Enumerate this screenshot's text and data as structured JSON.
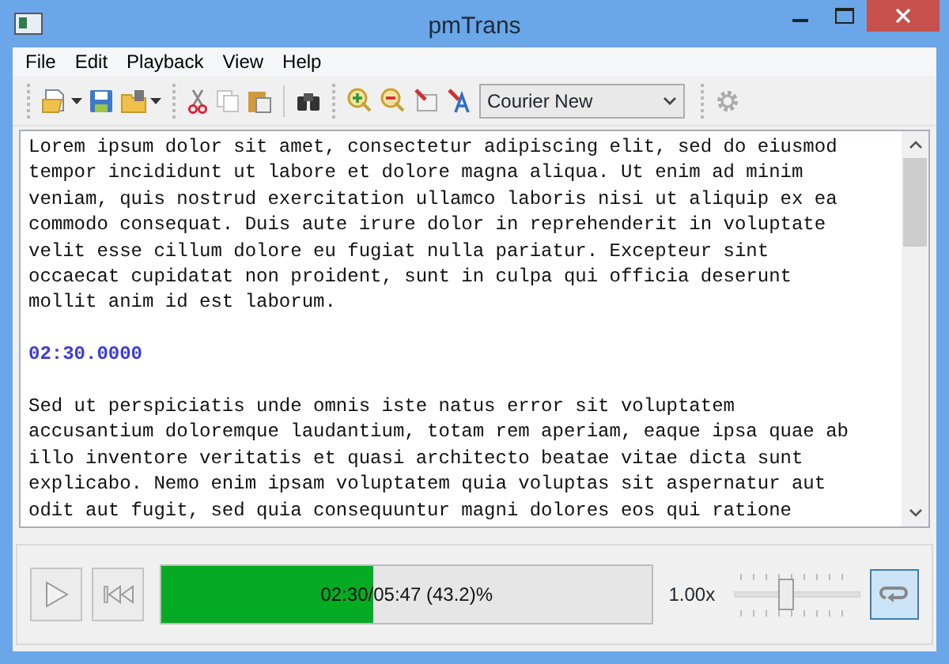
{
  "window": {
    "title": "pmTrans"
  },
  "menu": [
    "File",
    "Edit",
    "Playback",
    "View",
    "Help"
  ],
  "toolbar": {
    "font_select": {
      "value": "Courier New"
    }
  },
  "editor": {
    "blocks": [
      {
        "kind": "text",
        "lines": [
          "Lorem ipsum dolor sit amet, consectetur adipiscing elit, sed do eiusmod",
          "tempor incididunt ut labore et dolore magna aliqua. Ut enim ad minim",
          "veniam, quis nostrud exercitation ullamco laboris nisi ut aliquip ex ea",
          "commodo consequat. Duis aute irure dolor in reprehenderit in voluptate",
          "velit esse cillum dolore eu fugiat nulla pariatur. Excepteur sint",
          "occaecat cupidatat non proident, sunt in culpa qui officia deserunt",
          "mollit anim id est laborum."
        ]
      },
      {
        "kind": "timestamp",
        "text": "02:30.0000"
      },
      {
        "kind": "text",
        "lines": [
          "Sed ut perspiciatis unde omnis iste natus error sit voluptatem",
          "accusantium doloremque laudantium, totam rem aperiam, eaque ipsa quae ab",
          "illo inventore veritatis et quasi architecto beatae vitae dicta sunt",
          "explicabo. Nemo enim ipsam voluptatem quia voluptas sit aspernatur aut",
          "odit aut fugit, sed quia consequuntur magni dolores eos qui ratione"
        ]
      }
    ]
  },
  "player": {
    "progress": {
      "level": 0.432,
      "label": "02:30/05:47 (43.2)%"
    },
    "speed": "1.00x",
    "speed_slider": {
      "level": 0.42
    },
    "loop": {
      "checked": true
    }
  }
}
